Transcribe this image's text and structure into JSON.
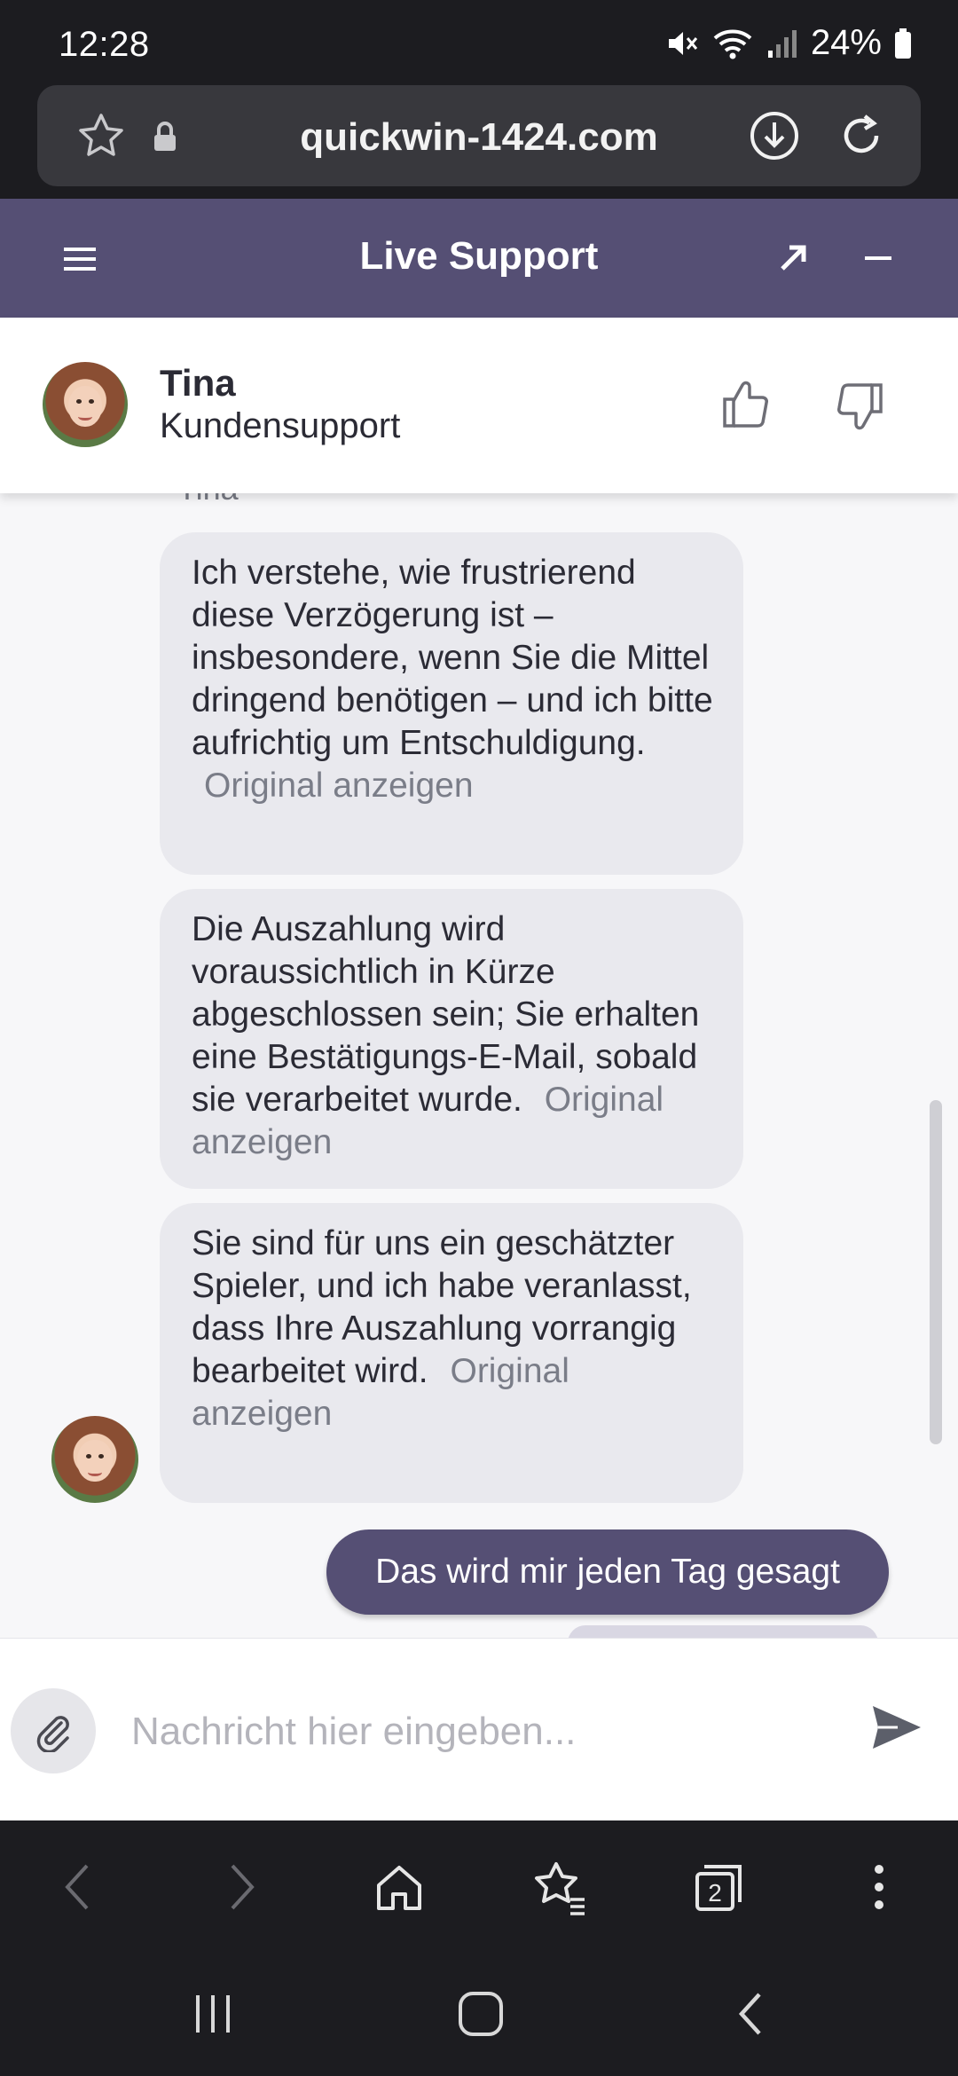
{
  "status_bar": {
    "time": "12:28",
    "battery": "24%"
  },
  "browser": {
    "url": "quickwin-1424.com"
  },
  "chat_header": {
    "title": "Live Support"
  },
  "agent": {
    "name": "Tina",
    "role": "Kundensupport"
  },
  "messages": {
    "sender_label": "Tina",
    "agent_messages": [
      {
        "text": "Ich verstehe, wie frustrierend diese Verzögerung ist – insbesondere, wenn Sie die Mittel dringend benötigen – und ich bitte aufrichtig um Entschuldigung.",
        "original_link": "Original anzeigen"
      },
      {
        "text": "Die Auszahlung wird voraussichtlich in Kürze abgeschlossen sein; Sie erhalten eine Bestätigungs-E-Mail, sobald sie verarbeitet wurde.",
        "original_link": "Original anzeigen"
      },
      {
        "text": "Sie sind für uns ein geschätzter Spieler, und ich habe veranlasst, dass Ihre Auszahlung vorrangig bearbeitet wird.",
        "original_link": "Original anzeigen"
      }
    ],
    "user_message": "Das wird mir jeden Tag gesagt"
  },
  "composer": {
    "placeholder": "Nachricht hier eingeben..."
  },
  "colors": {
    "accent": "#554f74",
    "bubble": "#e9e9ee",
    "chrome": "#1c1c20"
  },
  "icons": {
    "status": [
      "mute-icon",
      "wifi-icon",
      "signal-icon",
      "battery-icon"
    ],
    "browser": [
      "star-icon",
      "lock-icon",
      "download-icon",
      "reload-icon"
    ],
    "header": [
      "menu-icon",
      "expand-icon",
      "minimize-icon"
    ],
    "agent": [
      "thumbs-up-icon",
      "thumbs-down-icon"
    ],
    "composer": [
      "paperclip-icon",
      "send-icon"
    ],
    "bottom_nav": [
      "back-icon",
      "forward-icon",
      "home-icon",
      "bookmarks-icon",
      "tabs-icon",
      "more-icon"
    ],
    "system_nav": [
      "recents-icon",
      "home-circle-icon",
      "system-back-icon"
    ]
  },
  "tabs_count": "2"
}
